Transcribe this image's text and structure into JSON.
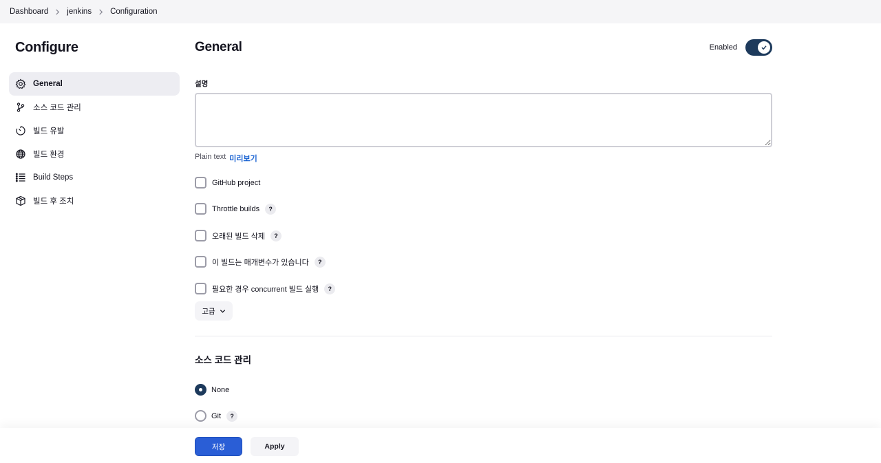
{
  "breadcrumb": {
    "items": [
      "Dashboard",
      "jenkins",
      "Configuration"
    ]
  },
  "sidebar": {
    "title": "Configure",
    "items": [
      {
        "label": "General",
        "icon": "gear-icon"
      },
      {
        "label": "소스 코드 관리",
        "icon": "branch-icon"
      },
      {
        "label": "빌드 유발",
        "icon": "timer-icon"
      },
      {
        "label": "빌드 환경",
        "icon": "globe-icon"
      },
      {
        "label": "Build Steps",
        "icon": "list-icon"
      },
      {
        "label": "빌드 후 조치",
        "icon": "package-icon"
      }
    ]
  },
  "general": {
    "title": "General",
    "enabled_label": "Enabled",
    "description_label": "설명",
    "description_value": "",
    "plain_text": "Plain text",
    "preview_link": "미리보기",
    "options": [
      {
        "label": "GitHub project",
        "checked": false,
        "help": false
      },
      {
        "label": "Throttle builds",
        "checked": false,
        "help": true
      },
      {
        "label": "오래된 빌드 삭제",
        "checked": false,
        "help": true
      },
      {
        "label": "이 빌드는 매개변수가 있습니다",
        "checked": false,
        "help": true
      },
      {
        "label": "필요한 경우 concurrent 빌드 실행",
        "checked": false,
        "help": true
      }
    ],
    "help_glyph": "?",
    "advanced_label": "고급"
  },
  "scm": {
    "title": "소스 코드 관리",
    "options": [
      {
        "label": "None",
        "selected": true,
        "help": false
      },
      {
        "label": "Git",
        "selected": false,
        "help": true
      }
    ]
  },
  "actions": {
    "save_label": "저장",
    "apply_label": "Apply"
  },
  "colors": {
    "accent": "#1d3a5c",
    "save_button": "#2a5ed6",
    "link": "#1660d1"
  }
}
